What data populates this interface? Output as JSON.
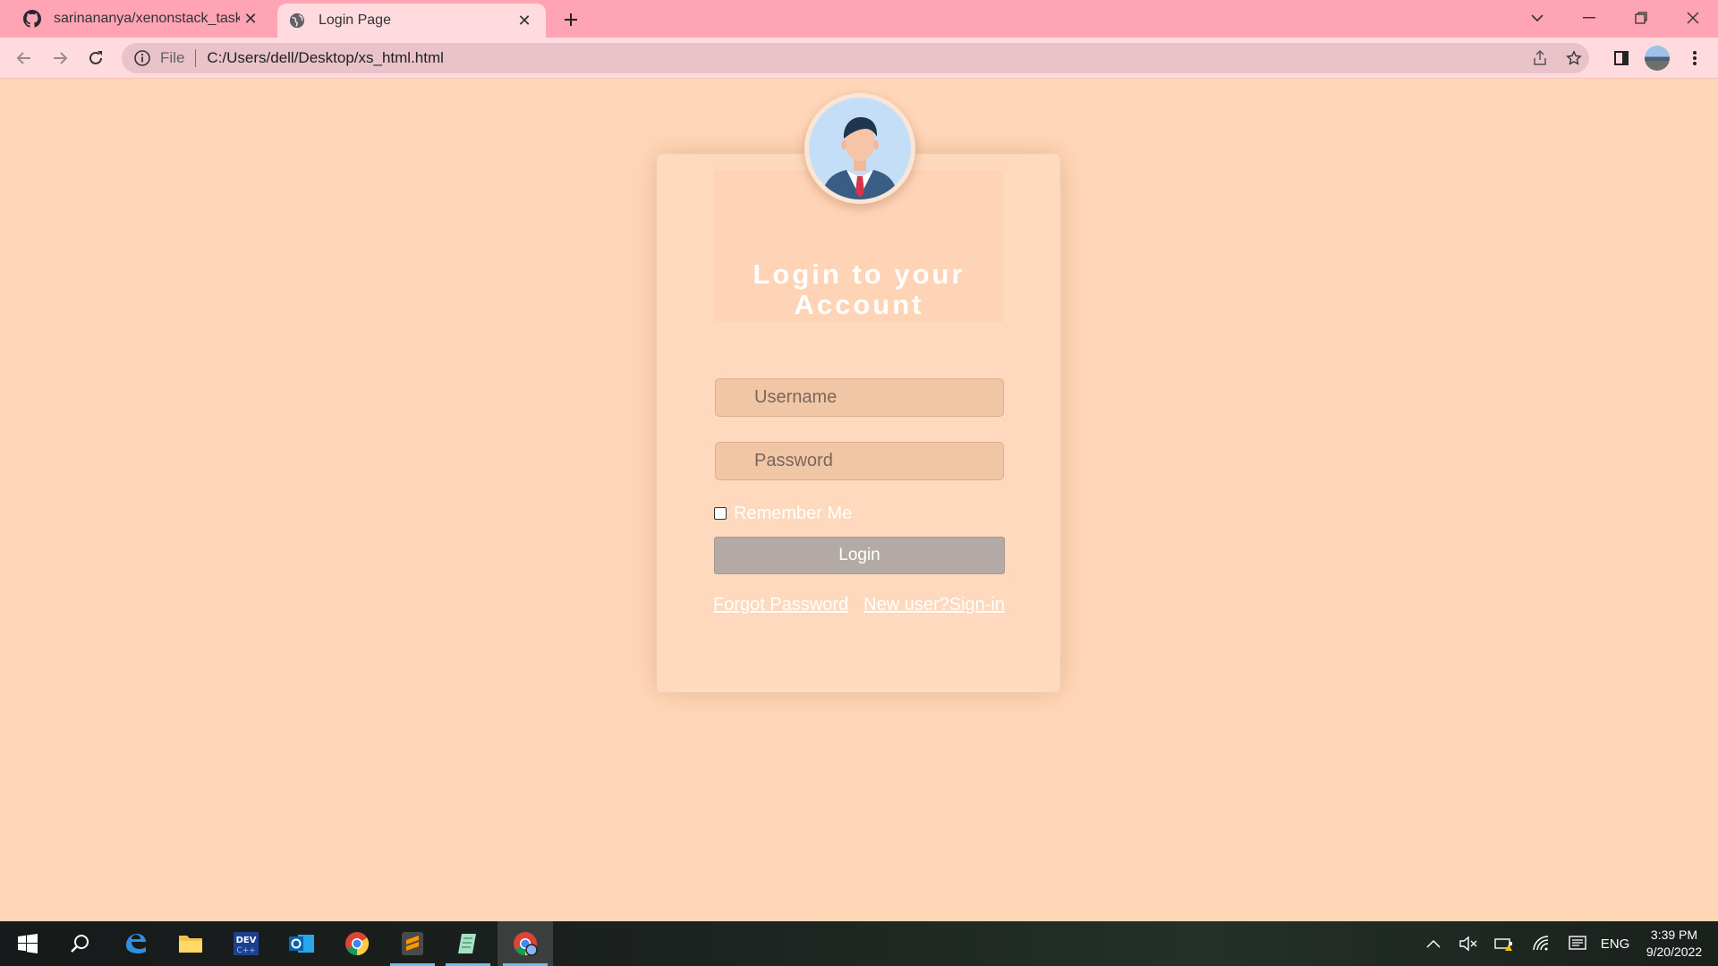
{
  "browser": {
    "tabs": [
      {
        "title": "sarinananya/xenonstack_task",
        "icon": "github-icon",
        "active": false
      },
      {
        "title": "Login Page",
        "icon": "globe-icon",
        "active": true
      }
    ],
    "address": {
      "scheme_label": "File",
      "url": "C:/Users/dell/Desktop/xs_html.html"
    }
  },
  "login": {
    "title": "Login to your Account",
    "username_placeholder": "Username",
    "password_placeholder": "Password",
    "remember_label": "Remember Me",
    "remember_checked": false,
    "login_button": "Login",
    "forgot_link": "Forgot Password",
    "signup_link": "New user?Sign-in"
  },
  "taskbar": {
    "apps": [
      "start",
      "search",
      "edge",
      "file-explorer",
      "devcpp",
      "outlook",
      "chrome",
      "sublime-text",
      "notepad-plus",
      "chrome-profile"
    ],
    "language": "ENG",
    "time": "3:39 PM",
    "date": "9/20/2022"
  },
  "colors": {
    "page_bg": "#ffd7b8",
    "tabstrip_bg": "#ffa4b4",
    "toolbar_bg": "#ffdbe0",
    "login_button_bg": "#b3aaa5"
  }
}
